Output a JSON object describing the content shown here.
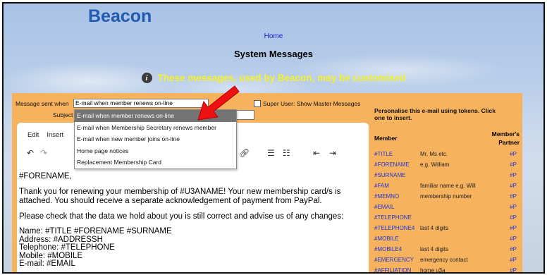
{
  "header": {
    "logo": "Beacon",
    "home_link": "Home",
    "page_title": "System Messages",
    "info_text": "These messages, used by Beacon, may be customised"
  },
  "form": {
    "sent_when_label": "Message sent when",
    "sent_when_value": "E-mail when member renews on-line",
    "super_user_label": "Super User: Show Master Messages",
    "subject_label": "Subject"
  },
  "dropdown": {
    "options": [
      "E-mail when member renews on-line",
      "E-mail when Membership Secretary renews member",
      "E-mail when new member joins on-line",
      "Home page notices",
      "Replacement Membership Card"
    ]
  },
  "editor": {
    "menu": [
      "Edit",
      "Insert"
    ],
    "content": [
      "#FORENAME,",
      "Thank you for renewing your membership of #U3ANAME! Your new membership card/s is attached. You should receive a separate acknowledgement of payment from PayPal.",
      "Please check that the data we hold about you is still correct and advise us of any changes:",
      "Name: #TITLE #FORENAME #SURNAME\nAddress: #ADDRESSH\nTelephone: #TELEPHONE\nMobile: #MOBILE\nE-mail: #EMAIL"
    ]
  },
  "tokens": {
    "instructions": "Personalise this e-mail using tokens. Click one to insert.",
    "header_member": "Member",
    "header_partner": "Member's Partner",
    "rows": [
      {
        "token": "#TITLE",
        "desc": "Mr, Ms etc.",
        "partner": "#P"
      },
      {
        "token": "#FORENAME",
        "desc": "e.g. William",
        "partner": "#P"
      },
      {
        "token": "#SURNAME",
        "desc": "",
        "partner": "#P"
      },
      {
        "token": "#FAM",
        "desc": "familiar name e.g. Will",
        "partner": "#P"
      },
      {
        "token": "#MEMNO",
        "desc": "membership number",
        "partner": "#P"
      },
      {
        "token": "#EMAIL",
        "desc": "",
        "partner": "#P"
      },
      {
        "token": "#TELEPHONE",
        "desc": "",
        "partner": "#P"
      },
      {
        "token": "#TELEPHONE4",
        "desc": "last 4 digits",
        "partner": "#P"
      },
      {
        "token": "#MOBILE",
        "desc": "",
        "partner": "#P"
      },
      {
        "token": "#MOBILE4",
        "desc": "last 4 digits",
        "partner": "#P"
      },
      {
        "token": "#EMERGENCY",
        "desc": "emergency contact",
        "partner": "#P"
      },
      {
        "token": "#AFFILIATION",
        "desc": "home u3a",
        "partner": "#P"
      }
    ]
  }
}
